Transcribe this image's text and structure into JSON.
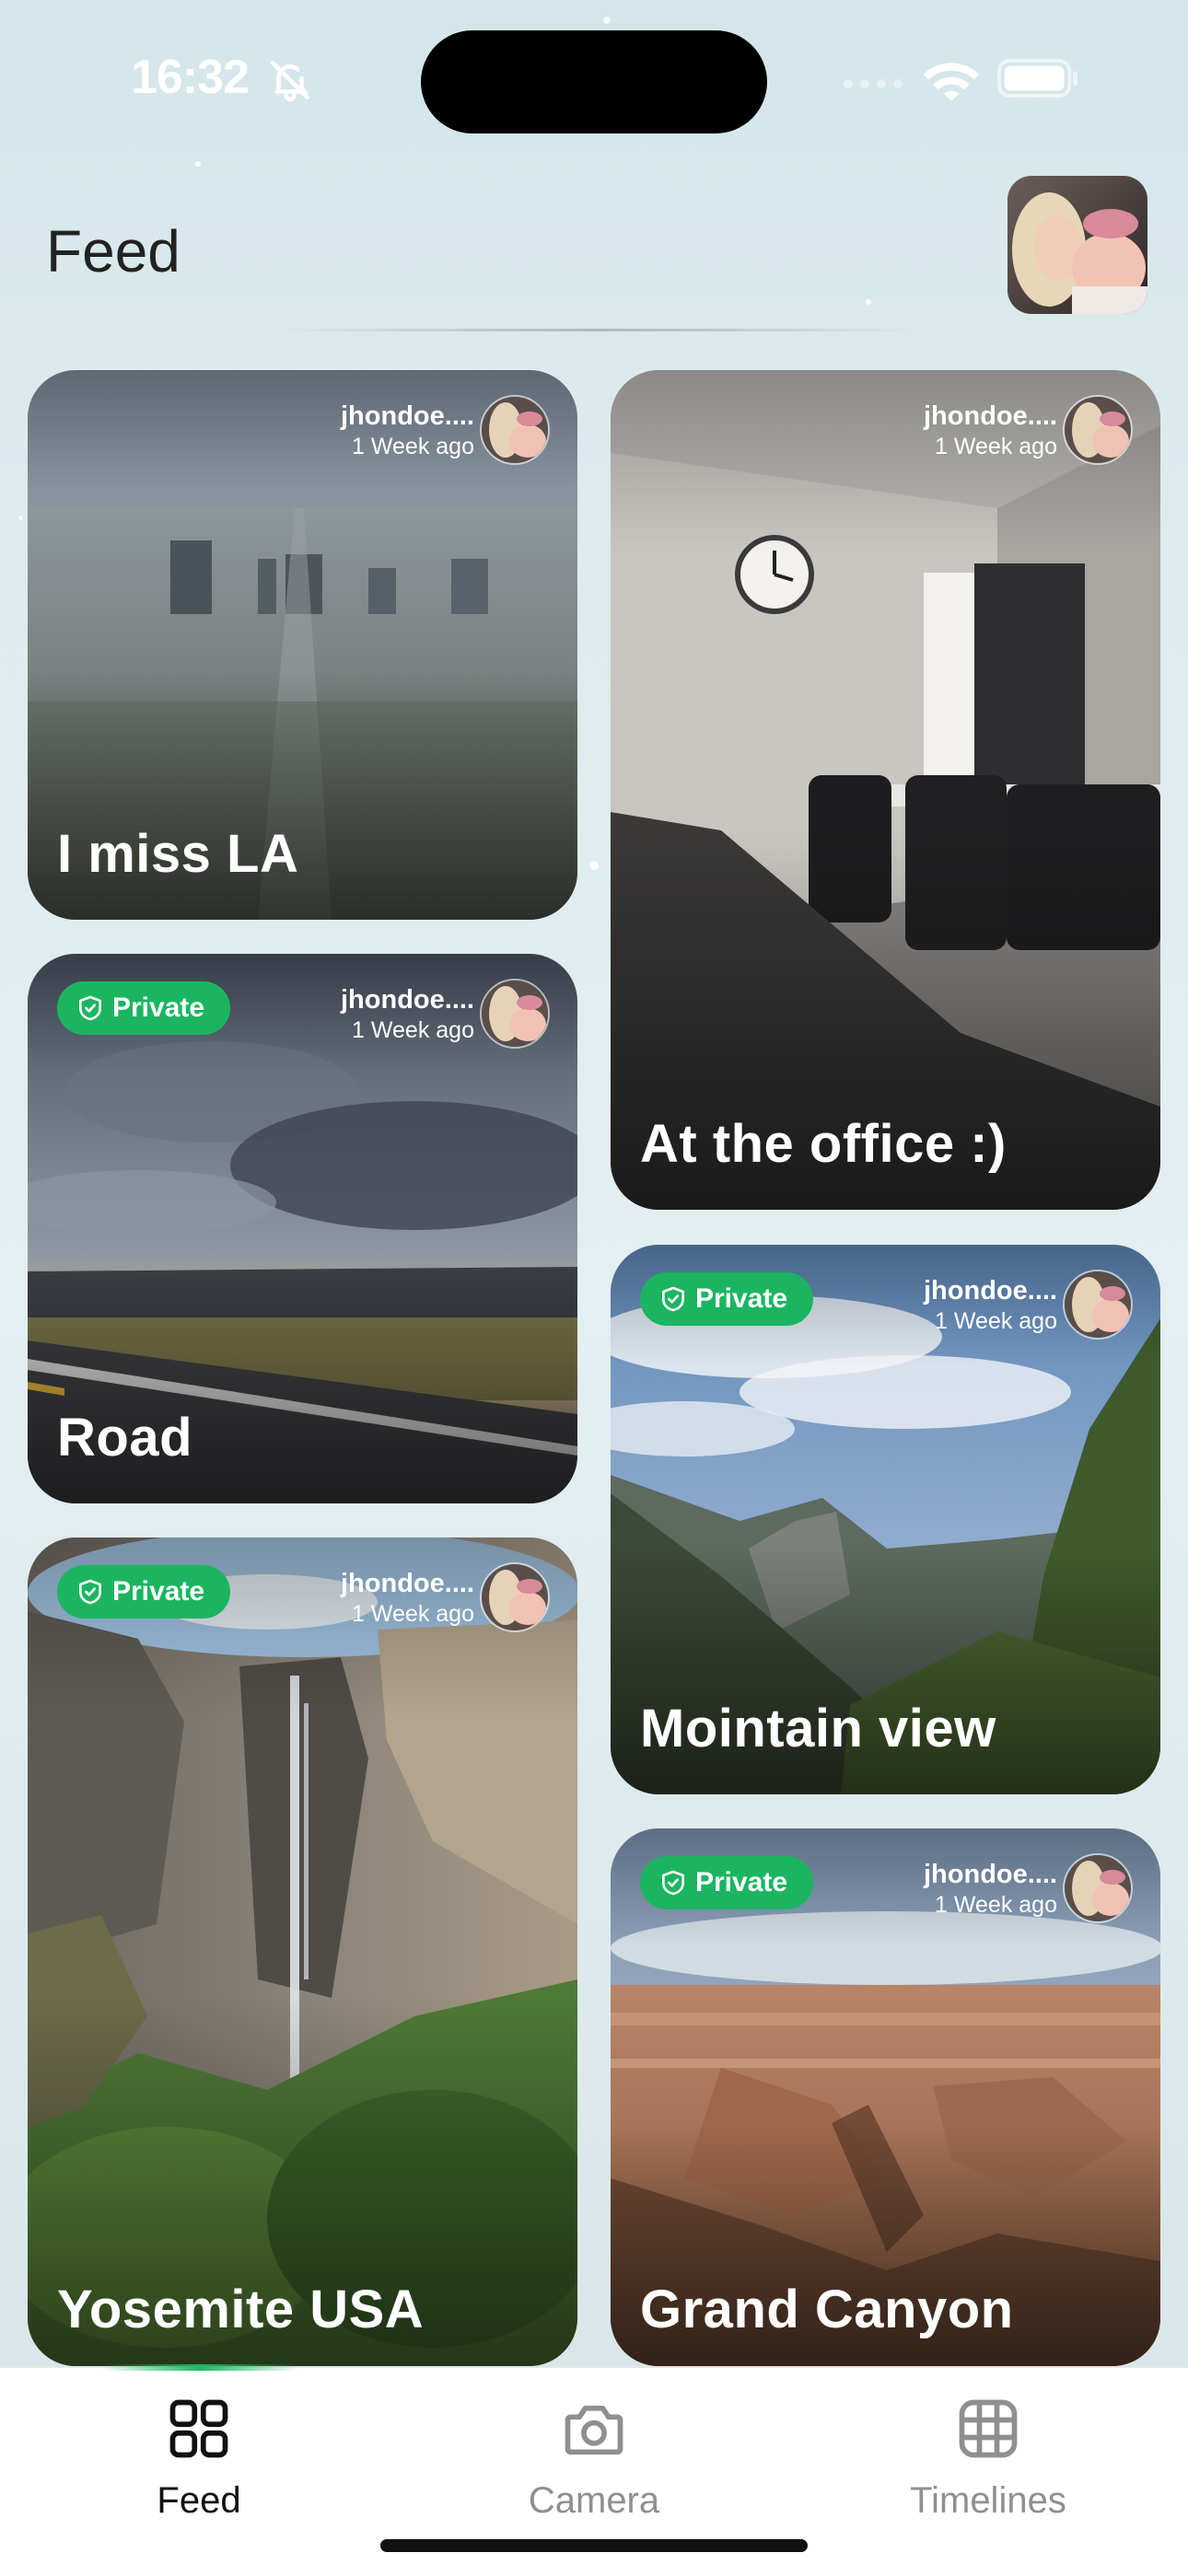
{
  "status_bar": {
    "time": "16:32"
  },
  "header": {
    "title": "Feed"
  },
  "colors": {
    "accent": "#1bb561",
    "private_badge": "#1bb561"
  },
  "feed": {
    "cards": [
      {
        "title": "I miss LA",
        "user": "jhondoe....",
        "when": "1 Week ago",
        "private": false
      },
      {
        "title": "At the office :)",
        "user": "jhondoe....",
        "when": "1 Week ago",
        "private": false
      },
      {
        "title": "Road",
        "user": "jhondoe....",
        "when": "1 Week ago",
        "private": true,
        "badge": "Private"
      },
      {
        "title": "Mointain view",
        "user": "jhondoe....",
        "when": "1 Week ago",
        "private": true,
        "badge": "Private"
      },
      {
        "title": "Yosemite USA",
        "user": "jhondoe....",
        "when": "1 Week ago",
        "private": true,
        "badge": "Private"
      },
      {
        "title": "Grand Canyon",
        "user": "jhondoe....",
        "when": "1 Week ago",
        "private": true,
        "badge": "Private"
      }
    ]
  },
  "nav": {
    "items": [
      {
        "label": "Feed",
        "icon": "grid-icon",
        "active": true
      },
      {
        "label": "Camera",
        "icon": "camera-icon",
        "active": false
      },
      {
        "label": "Timelines",
        "icon": "film-grid-icon",
        "active": false
      }
    ]
  }
}
